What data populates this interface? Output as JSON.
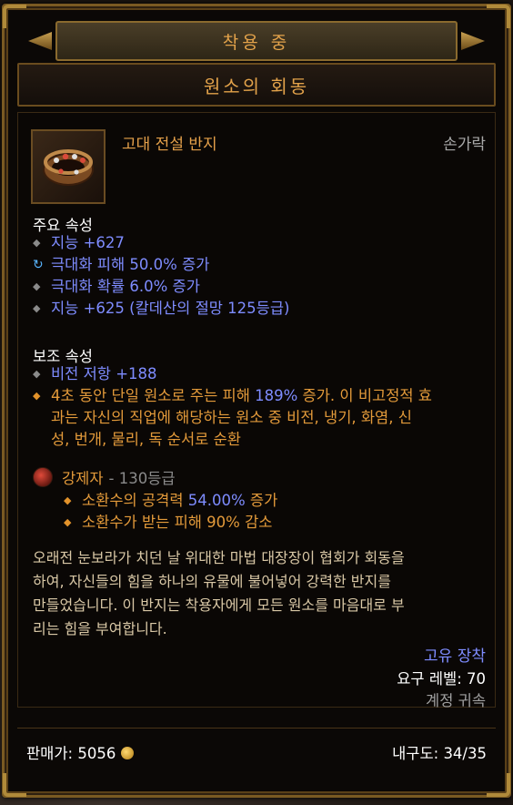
{
  "header": {
    "equipped_label": "착용 중",
    "item_name": "원소의 회동"
  },
  "item": {
    "type": "고대 전설 반지",
    "slot": "손가락",
    "icon": "ring-icon"
  },
  "primary": {
    "title": "주요 속성",
    "props": [
      {
        "text": "지능 +627",
        "bullet": "diamond"
      },
      {
        "text": "극대화 피해 50.0% 증가",
        "bullet": "enchanted"
      },
      {
        "text": "극대화 확률 6.0% 증가",
        "bullet": "diamond"
      },
      {
        "text": "지능 +625 (칼데산의 절망 125등급)",
        "bullet": "diamond"
      }
    ]
  },
  "secondary": {
    "title": "보조 속성",
    "props": [
      {
        "text": "비전 저항 +188",
        "bullet": "diamond"
      }
    ],
    "legendary": {
      "line1_a": "4초 동안 단일 원소로 주는 피해 ",
      "line1_num": "189%",
      "line1_b": " 증가. 이 비고정적 효",
      "line2": "과는 자신의 직업에 해당하는 원소 중 비전, 냉기, 화염, 신",
      "line3": "성, 번개, 물리, 독 순서로 순환"
    }
  },
  "forged": {
    "name": "강제자",
    "rank": "- 130등급",
    "icon": "forge-power-icon",
    "props": [
      {
        "a": "소환수의 공격력 ",
        "num": "54.00%",
        "b": " 증가"
      },
      {
        "a": "소환수가 받는 피해 90% 감소",
        "num": "",
        "b": ""
      }
    ]
  },
  "flavor": [
    "오래전 눈보라가 치던 날 위대한 마법 대장장이 협회가 회동을",
    "하여, 자신들의 힘을 하나의 유물에 불어넣어 강력한 반지를",
    "만들었습니다. 이 반지는 착용자에게 모든 원소를 마음대로 부",
    "리는 힘을 부여합니다."
  ],
  "meta": {
    "unique": "고유 장착",
    "required_level": "요구 레벨: 70",
    "bound": "계정 귀속"
  },
  "footer": {
    "sell_price": "판매가: 5056",
    "durability": "내구도: 34/35"
  },
  "colors": {
    "gold": "#e4a04a",
    "magic_blue": "#7e8cff",
    "legendary_orange": "#e39a3a",
    "flavor": "#d9c8a6"
  }
}
